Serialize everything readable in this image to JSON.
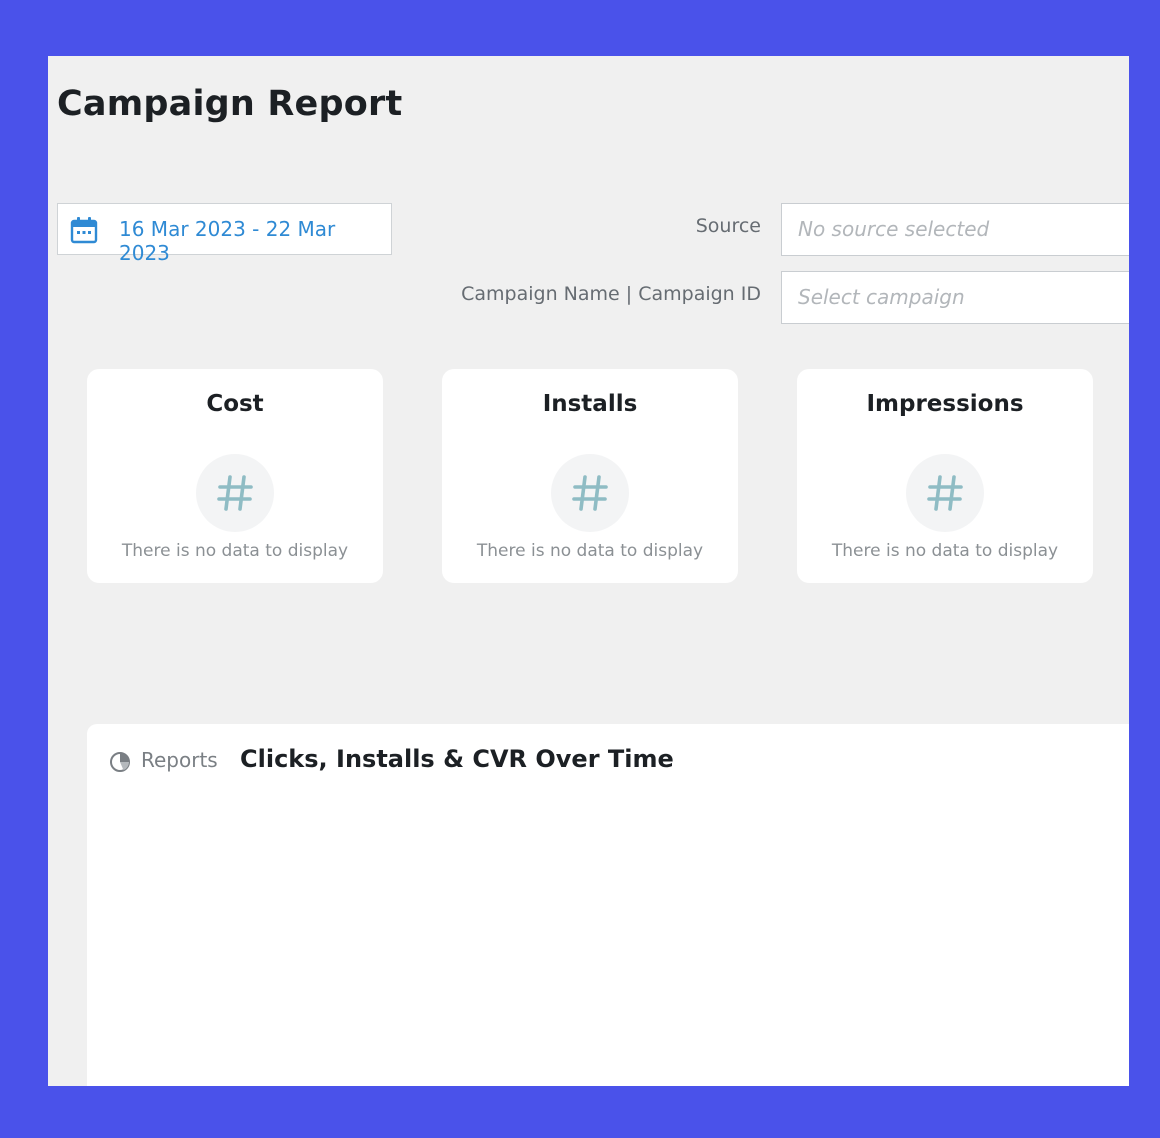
{
  "page": {
    "title": "Campaign Report"
  },
  "filters": {
    "date_range": "16 Mar 2023 - 22 Mar 2023",
    "source_label": "Source",
    "source_placeholder": "No source selected",
    "campaign_label": "Campaign Name | Campaign ID",
    "campaign_placeholder": "Select campaign"
  },
  "kpis": [
    {
      "title": "Cost",
      "empty_message": "There is no data to display",
      "icon": "hash-icon"
    },
    {
      "title": "Installs",
      "empty_message": "There is no data to display",
      "icon": "hash-icon"
    },
    {
      "title": "Impressions",
      "empty_message": "There is no data to display",
      "icon": "hash-icon"
    }
  ],
  "report": {
    "tab_label": "Reports",
    "tab_icon": "pie-chart-icon",
    "title": "Clicks, Installs & CVR Over Time"
  },
  "colors": {
    "background": "#4a52ea",
    "accent_blue": "#2f8ad4",
    "hash_icon": "#8fbcc4"
  }
}
